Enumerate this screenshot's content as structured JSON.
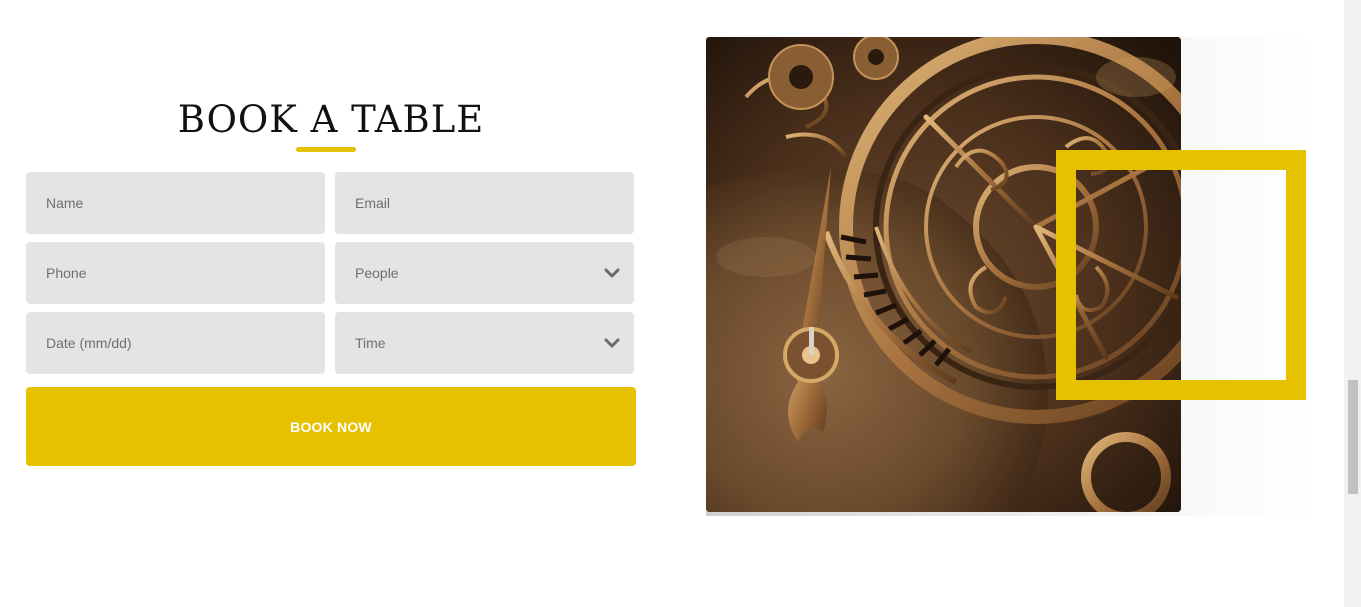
{
  "colors": {
    "accent": "#e5c100",
    "field_background": "#e4e4e4"
  },
  "booking": {
    "title": "BOOK A TABLE",
    "fields": {
      "name": {
        "placeholder": "Name"
      },
      "email": {
        "placeholder": "Email"
      },
      "phone": {
        "placeholder": "Phone"
      },
      "people": {
        "selected": "People",
        "icon": "chevron-down-icon"
      },
      "date": {
        "placeholder": "Date (mm/dd)"
      },
      "time": {
        "selected": "Time",
        "icon": "chevron-down-icon"
      }
    },
    "submit_label": "BOOK NOW"
  },
  "image": {
    "subject": "steampunk-gear-clock",
    "alt": ""
  }
}
